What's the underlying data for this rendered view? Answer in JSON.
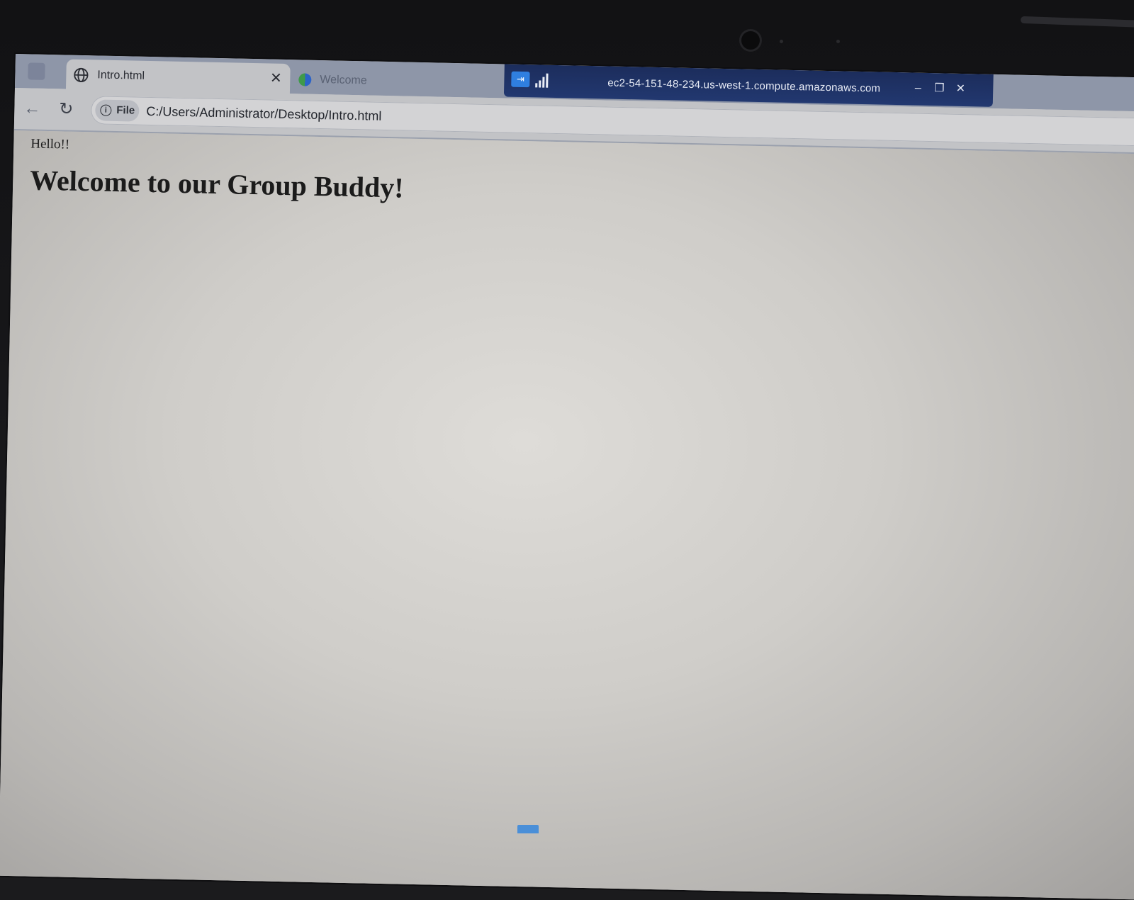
{
  "browser": {
    "tabs": [
      {
        "title": "Intro.html",
        "active": true,
        "icon": "globe-icon"
      },
      {
        "title": "Welcome",
        "active": false,
        "icon": "welcome-favicon"
      }
    ],
    "address_bar": {
      "chip_label": "File",
      "url": "C:/Users/Administrator/Desktop/Intro.html"
    }
  },
  "remote_session": {
    "host": "ec2-54-151-48-234.us-west-1.compute.amazonaws.com",
    "pin_icon": "⇥"
  },
  "page": {
    "greeting": "Hello!!",
    "heading": "Welcome to our Group Buddy!"
  },
  "colors": {
    "remote_bar": "#1c2d5c",
    "tabstrip": "#8e96a8",
    "page_background": "#d6d4d0"
  }
}
